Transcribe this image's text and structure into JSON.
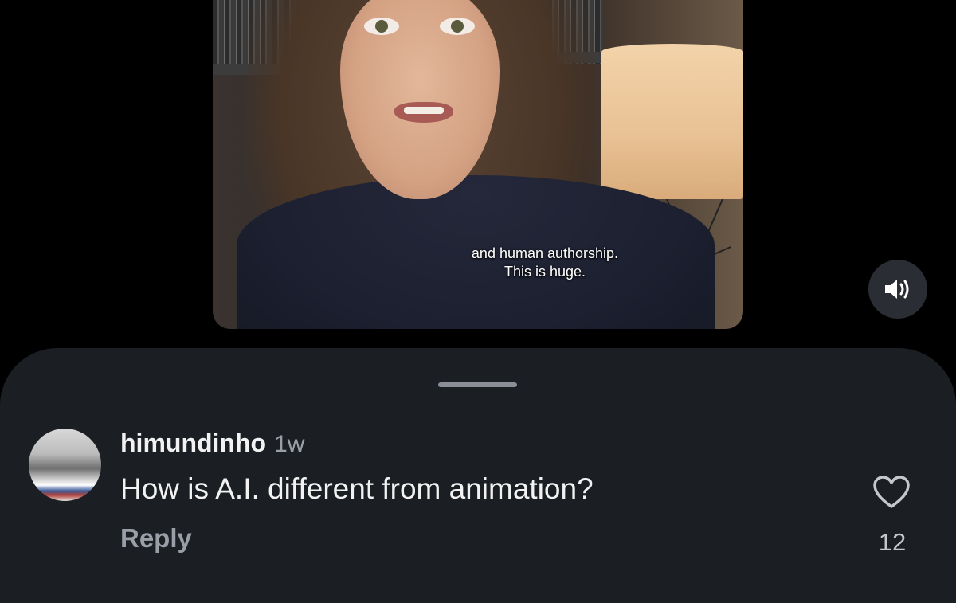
{
  "video": {
    "caption_line1": "and human authorship.",
    "caption_line2": "This is huge.",
    "audio_icon": "speaker-volume-icon"
  },
  "comment": {
    "username": "himundinho",
    "time": "1w",
    "text": "How is A.I. different from animation?",
    "reply_label": "Reply",
    "like_icon": "heart-outline-icon",
    "like_count": "12"
  },
  "colors": {
    "sheet_background": "#1b1e23",
    "page_background": "#000000",
    "muted_text": "#9a9ea6"
  }
}
